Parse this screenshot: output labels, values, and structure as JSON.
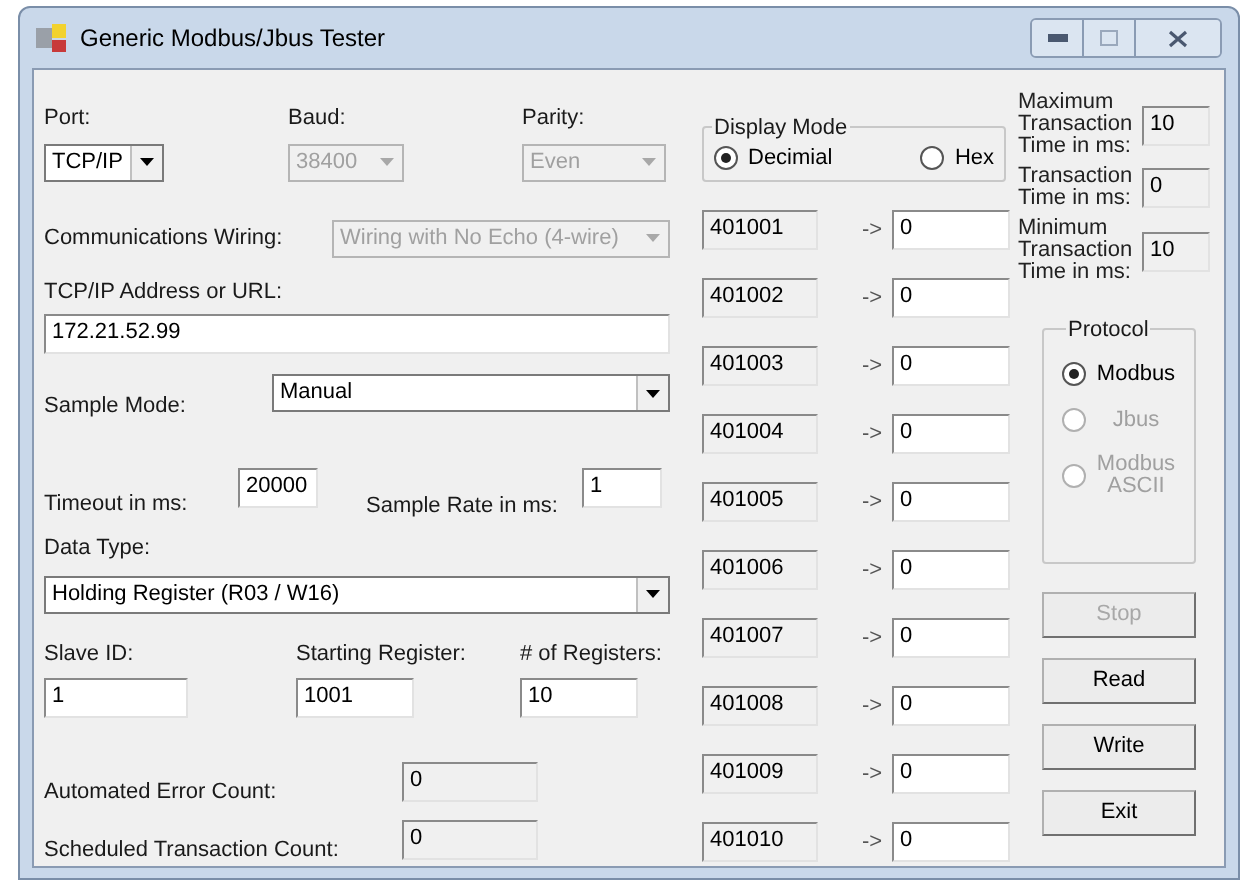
{
  "window": {
    "title": "Generic Modbus/Jbus Tester"
  },
  "port": {
    "label": "Port:",
    "value": "TCP/IP",
    "disabled": false
  },
  "baud": {
    "label": "Baud:",
    "value": "38400",
    "disabled": true
  },
  "parity": {
    "label": "Parity:",
    "value": "Even",
    "disabled": true
  },
  "wiring": {
    "label": "Communications Wiring:",
    "value": "Wiring with No Echo (4-wire)",
    "disabled": true
  },
  "address": {
    "label": "TCP/IP Address or URL:",
    "value": "172.21.52.99"
  },
  "sample_mode": {
    "label": "Sample Mode:",
    "value": "Manual",
    "disabled": false
  },
  "timeout": {
    "label": "Timeout in ms:",
    "value": "20000"
  },
  "sample_rate": {
    "label": "Sample Rate in ms:",
    "value": "1"
  },
  "data_type": {
    "label": "Data Type:",
    "value": "Holding Register (R03 / W16)",
    "disabled": false
  },
  "slave_id": {
    "label": "Slave ID:",
    "value": "1"
  },
  "starting_register": {
    "label": "Starting Register:",
    "value": "1001"
  },
  "register_count": {
    "label": "# of Registers:",
    "value": "10"
  },
  "error_count": {
    "label": "Automated Error Count:",
    "value": "0"
  },
  "scheduled_count": {
    "label": "Scheduled Transaction Count:",
    "value": "0"
  },
  "display_mode": {
    "title": "Display Mode",
    "options": [
      {
        "label": "Decimial",
        "selected": true
      },
      {
        "label": "Hex",
        "selected": false
      }
    ]
  },
  "registers": [
    {
      "address": "401001",
      "arrow": "->",
      "value": "0"
    },
    {
      "address": "401002",
      "arrow": "->",
      "value": "0"
    },
    {
      "address": "401003",
      "arrow": "->",
      "value": "0"
    },
    {
      "address": "401004",
      "arrow": "->",
      "value": "0"
    },
    {
      "address": "401005",
      "arrow": "->",
      "value": "0"
    },
    {
      "address": "401006",
      "arrow": "->",
      "value": "0"
    },
    {
      "address": "401007",
      "arrow": "->",
      "value": "0"
    },
    {
      "address": "401008",
      "arrow": "->",
      "value": "0"
    },
    {
      "address": "401009",
      "arrow": "->",
      "value": "0"
    },
    {
      "address": "401010",
      "arrow": "->",
      "value": "0"
    }
  ],
  "timings": [
    {
      "label": "Maximum Transaction Time in ms:",
      "value": "10"
    },
    {
      "label": "Transaction Time in ms:",
      "value": "0"
    },
    {
      "label": "Minimum Transaction Time in ms:",
      "value": "10"
    }
  ],
  "protocol": {
    "title": "Protocol",
    "options": [
      {
        "label": "Modbus",
        "selected": true,
        "disabled": false
      },
      {
        "label": "Jbus",
        "selected": false,
        "disabled": true
      },
      {
        "label": "Modbus ASCII",
        "selected": false,
        "disabled": true
      }
    ]
  },
  "buttons": [
    {
      "label": "Stop",
      "disabled": true
    },
    {
      "label": "Read",
      "disabled": false
    },
    {
      "label": "Write",
      "disabled": false
    },
    {
      "label": "Exit",
      "disabled": false
    }
  ]
}
